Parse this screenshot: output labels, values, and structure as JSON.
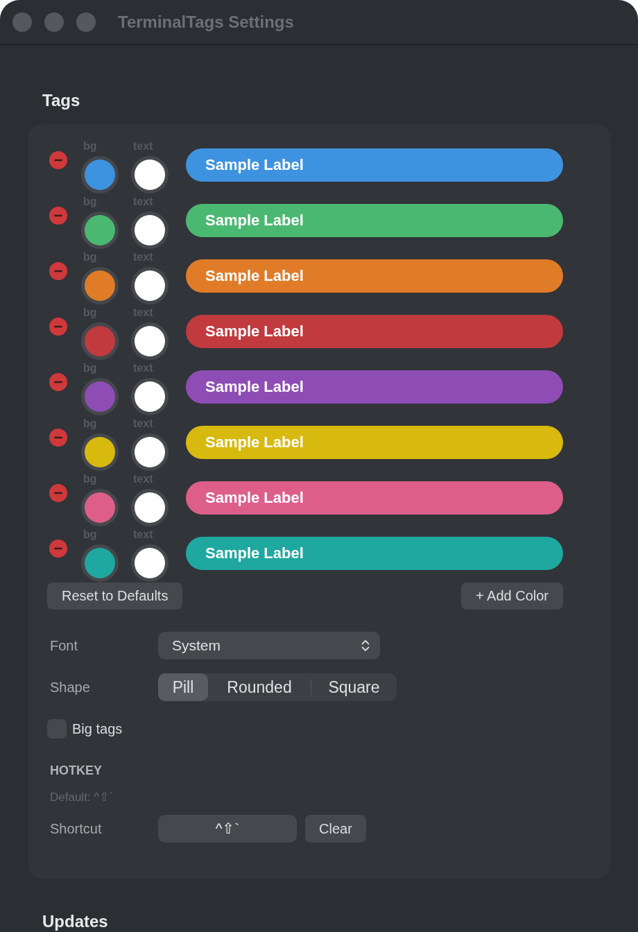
{
  "window": {
    "title": "TerminalTags Settings"
  },
  "tags_section": {
    "heading": "Tags",
    "tags": [
      {
        "bg_well": {
          "label": "bg",
          "color": "#3d93df"
        },
        "text_well": {
          "label": "text",
          "color": "#ffffff"
        },
        "label": "Sample Label"
      },
      {
        "bg_well": {
          "label": "bg",
          "color": "#4bb872"
        },
        "text_well": {
          "label": "text",
          "color": "#ffffff"
        },
        "label": "Sample Label"
      },
      {
        "bg_well": {
          "label": "bg",
          "color": "#e07c28"
        },
        "text_well": {
          "label": "text",
          "color": "#ffffff"
        },
        "label": "Sample Label"
      },
      {
        "bg_well": {
          "label": "bg",
          "color": "#c13a3d"
        },
        "text_well": {
          "label": "text",
          "color": "#ffffff"
        },
        "label": "Sample Label"
      },
      {
        "bg_well": {
          "label": "bg",
          "color": "#8e4db4"
        },
        "text_well": {
          "label": "text",
          "color": "#ffffff"
        },
        "label": "Sample Label"
      },
      {
        "bg_well": {
          "label": "bg",
          "color": "#d8b90f"
        },
        "text_well": {
          "label": "text",
          "color": "#ffffff"
        },
        "label": "Sample Label"
      },
      {
        "bg_well": {
          "label": "bg",
          "color": "#dd5f89"
        },
        "text_well": {
          "label": "text",
          "color": "#ffffff"
        },
        "label": "Sample Label"
      },
      {
        "bg_well": {
          "label": "bg",
          "color": "#1fa8a0"
        },
        "text_well": {
          "label": "text",
          "color": "#ffffff"
        },
        "label": "Sample Label"
      }
    ],
    "reset_button": "Reset to Defaults",
    "add_button": "+ Add Color",
    "font": {
      "label": "Font",
      "value": "System"
    },
    "shape": {
      "label": "Shape",
      "options": [
        {
          "label": "Pill",
          "selected": true
        },
        {
          "label": "Rounded",
          "selected": false
        },
        {
          "label": "Square",
          "selected": false
        }
      ]
    },
    "big_tags": {
      "label": "Big tags",
      "checked": false
    },
    "hotkey": {
      "heading": "HOTKEY",
      "default_hint": "Default: ^⇧`",
      "label": "Shortcut",
      "value": "^⇧`",
      "clear_button": "Clear"
    }
  },
  "updates_section": {
    "heading": "Updates"
  }
}
